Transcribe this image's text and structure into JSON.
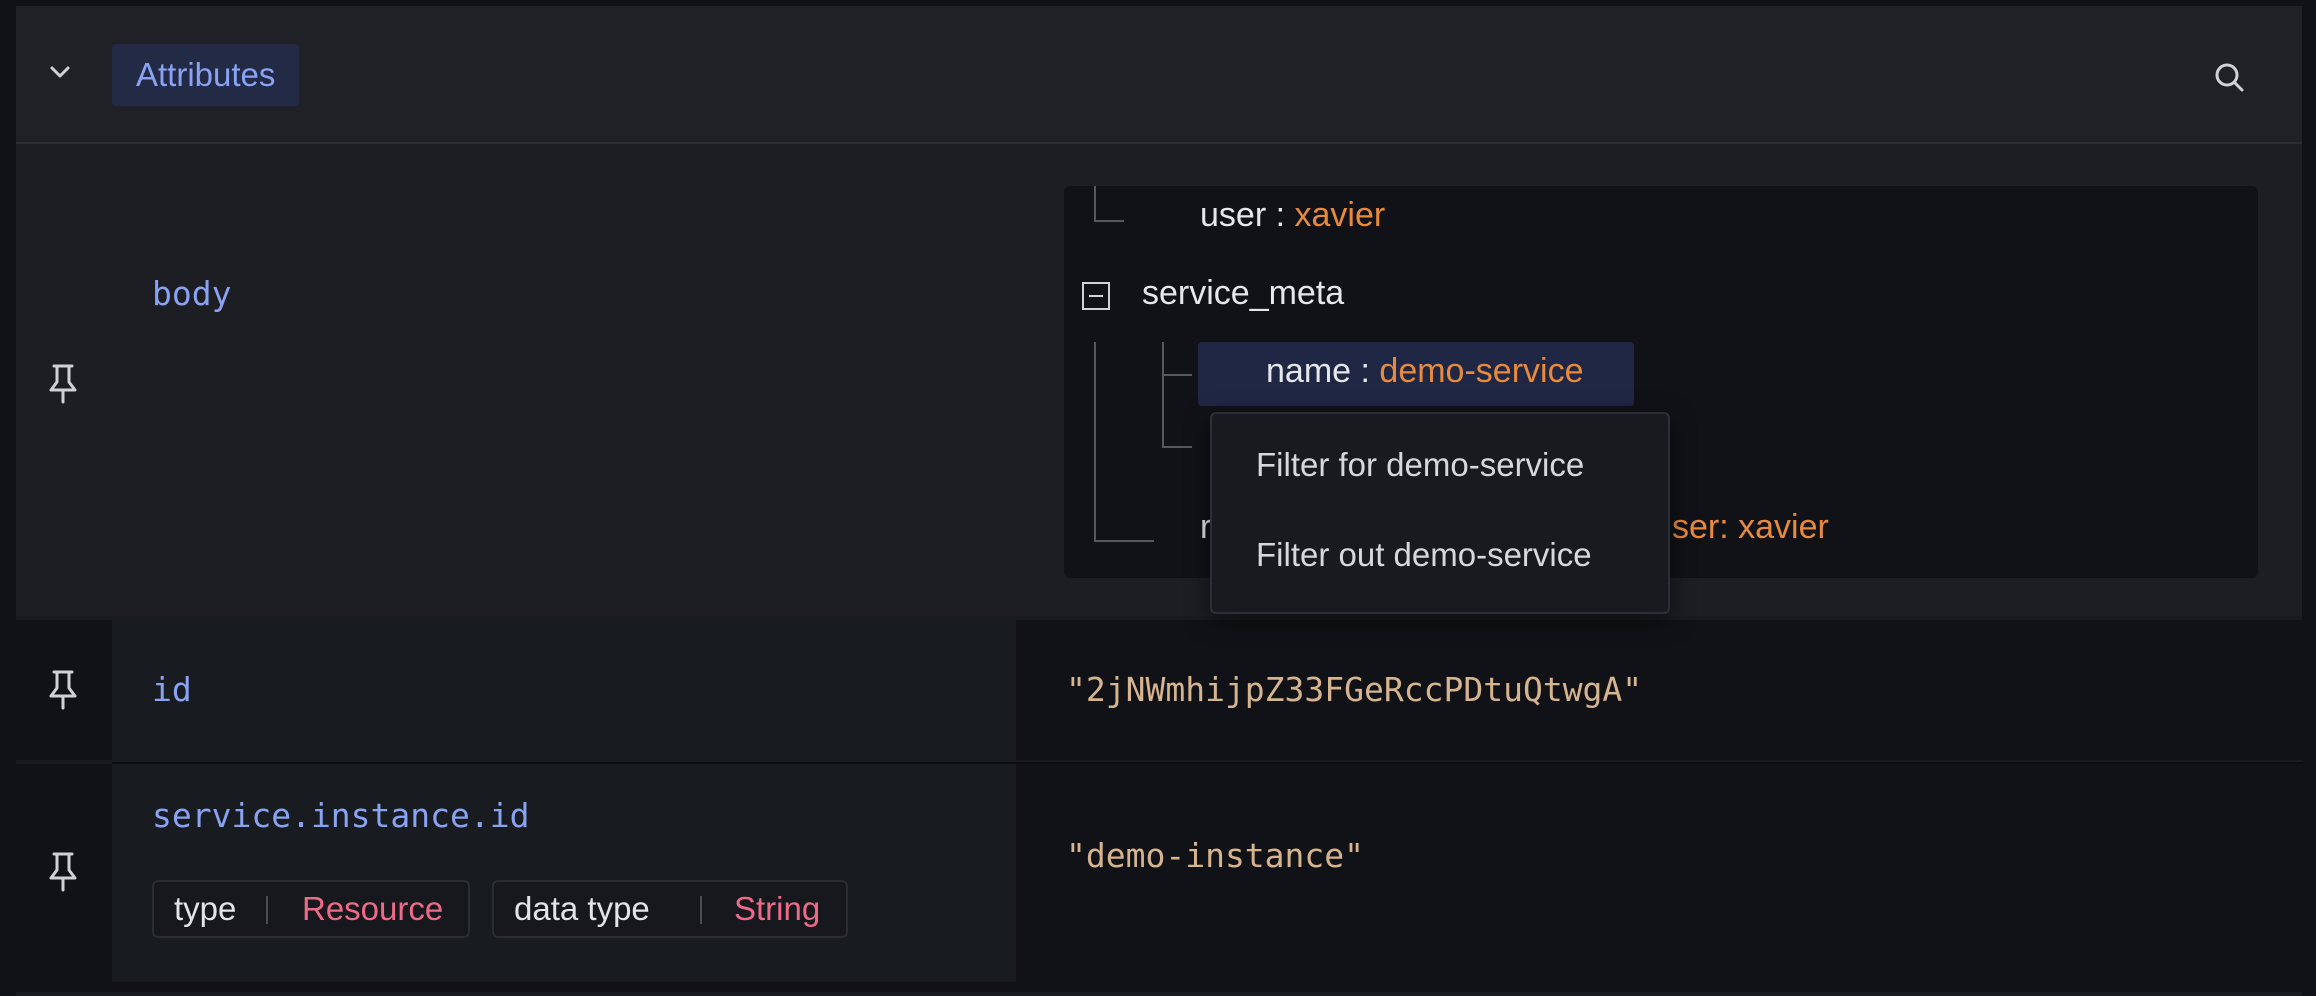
{
  "section": {
    "title": "Attributes",
    "collapse_icon": "chevron-down-icon",
    "search_icon": "search-icon"
  },
  "rows": [
    {
      "key": "body",
      "pin_icon": "pin-icon",
      "tree": {
        "user_key": "user :",
        "user_value": "xavier",
        "group_key": "service_meta",
        "name_key": "name :",
        "name_value": "demo-service",
        "last_key_visible": "r",
        "last_value_visible": "ser: xavier"
      }
    },
    {
      "key": "id",
      "pin_icon": "pin-icon",
      "value": "\"2jNWmhijpZ33FGeRccPDtuQtwgA\""
    },
    {
      "key": "service.instance.id",
      "pin_icon": "pin-icon",
      "value": "\"demo-instance\"",
      "chips": [
        {
          "label": "type",
          "value": "Resource"
        },
        {
          "label": "data type",
          "value": "String"
        }
      ]
    }
  ],
  "context_menu": {
    "items": [
      "Filter for demo-service",
      "Filter out demo-service"
    ]
  },
  "colors": {
    "key_blue": "#8aa2f2",
    "value_orange": "#e88a3c",
    "string_tan": "#d5b48e",
    "chip_pink": "#ee6a87"
  }
}
